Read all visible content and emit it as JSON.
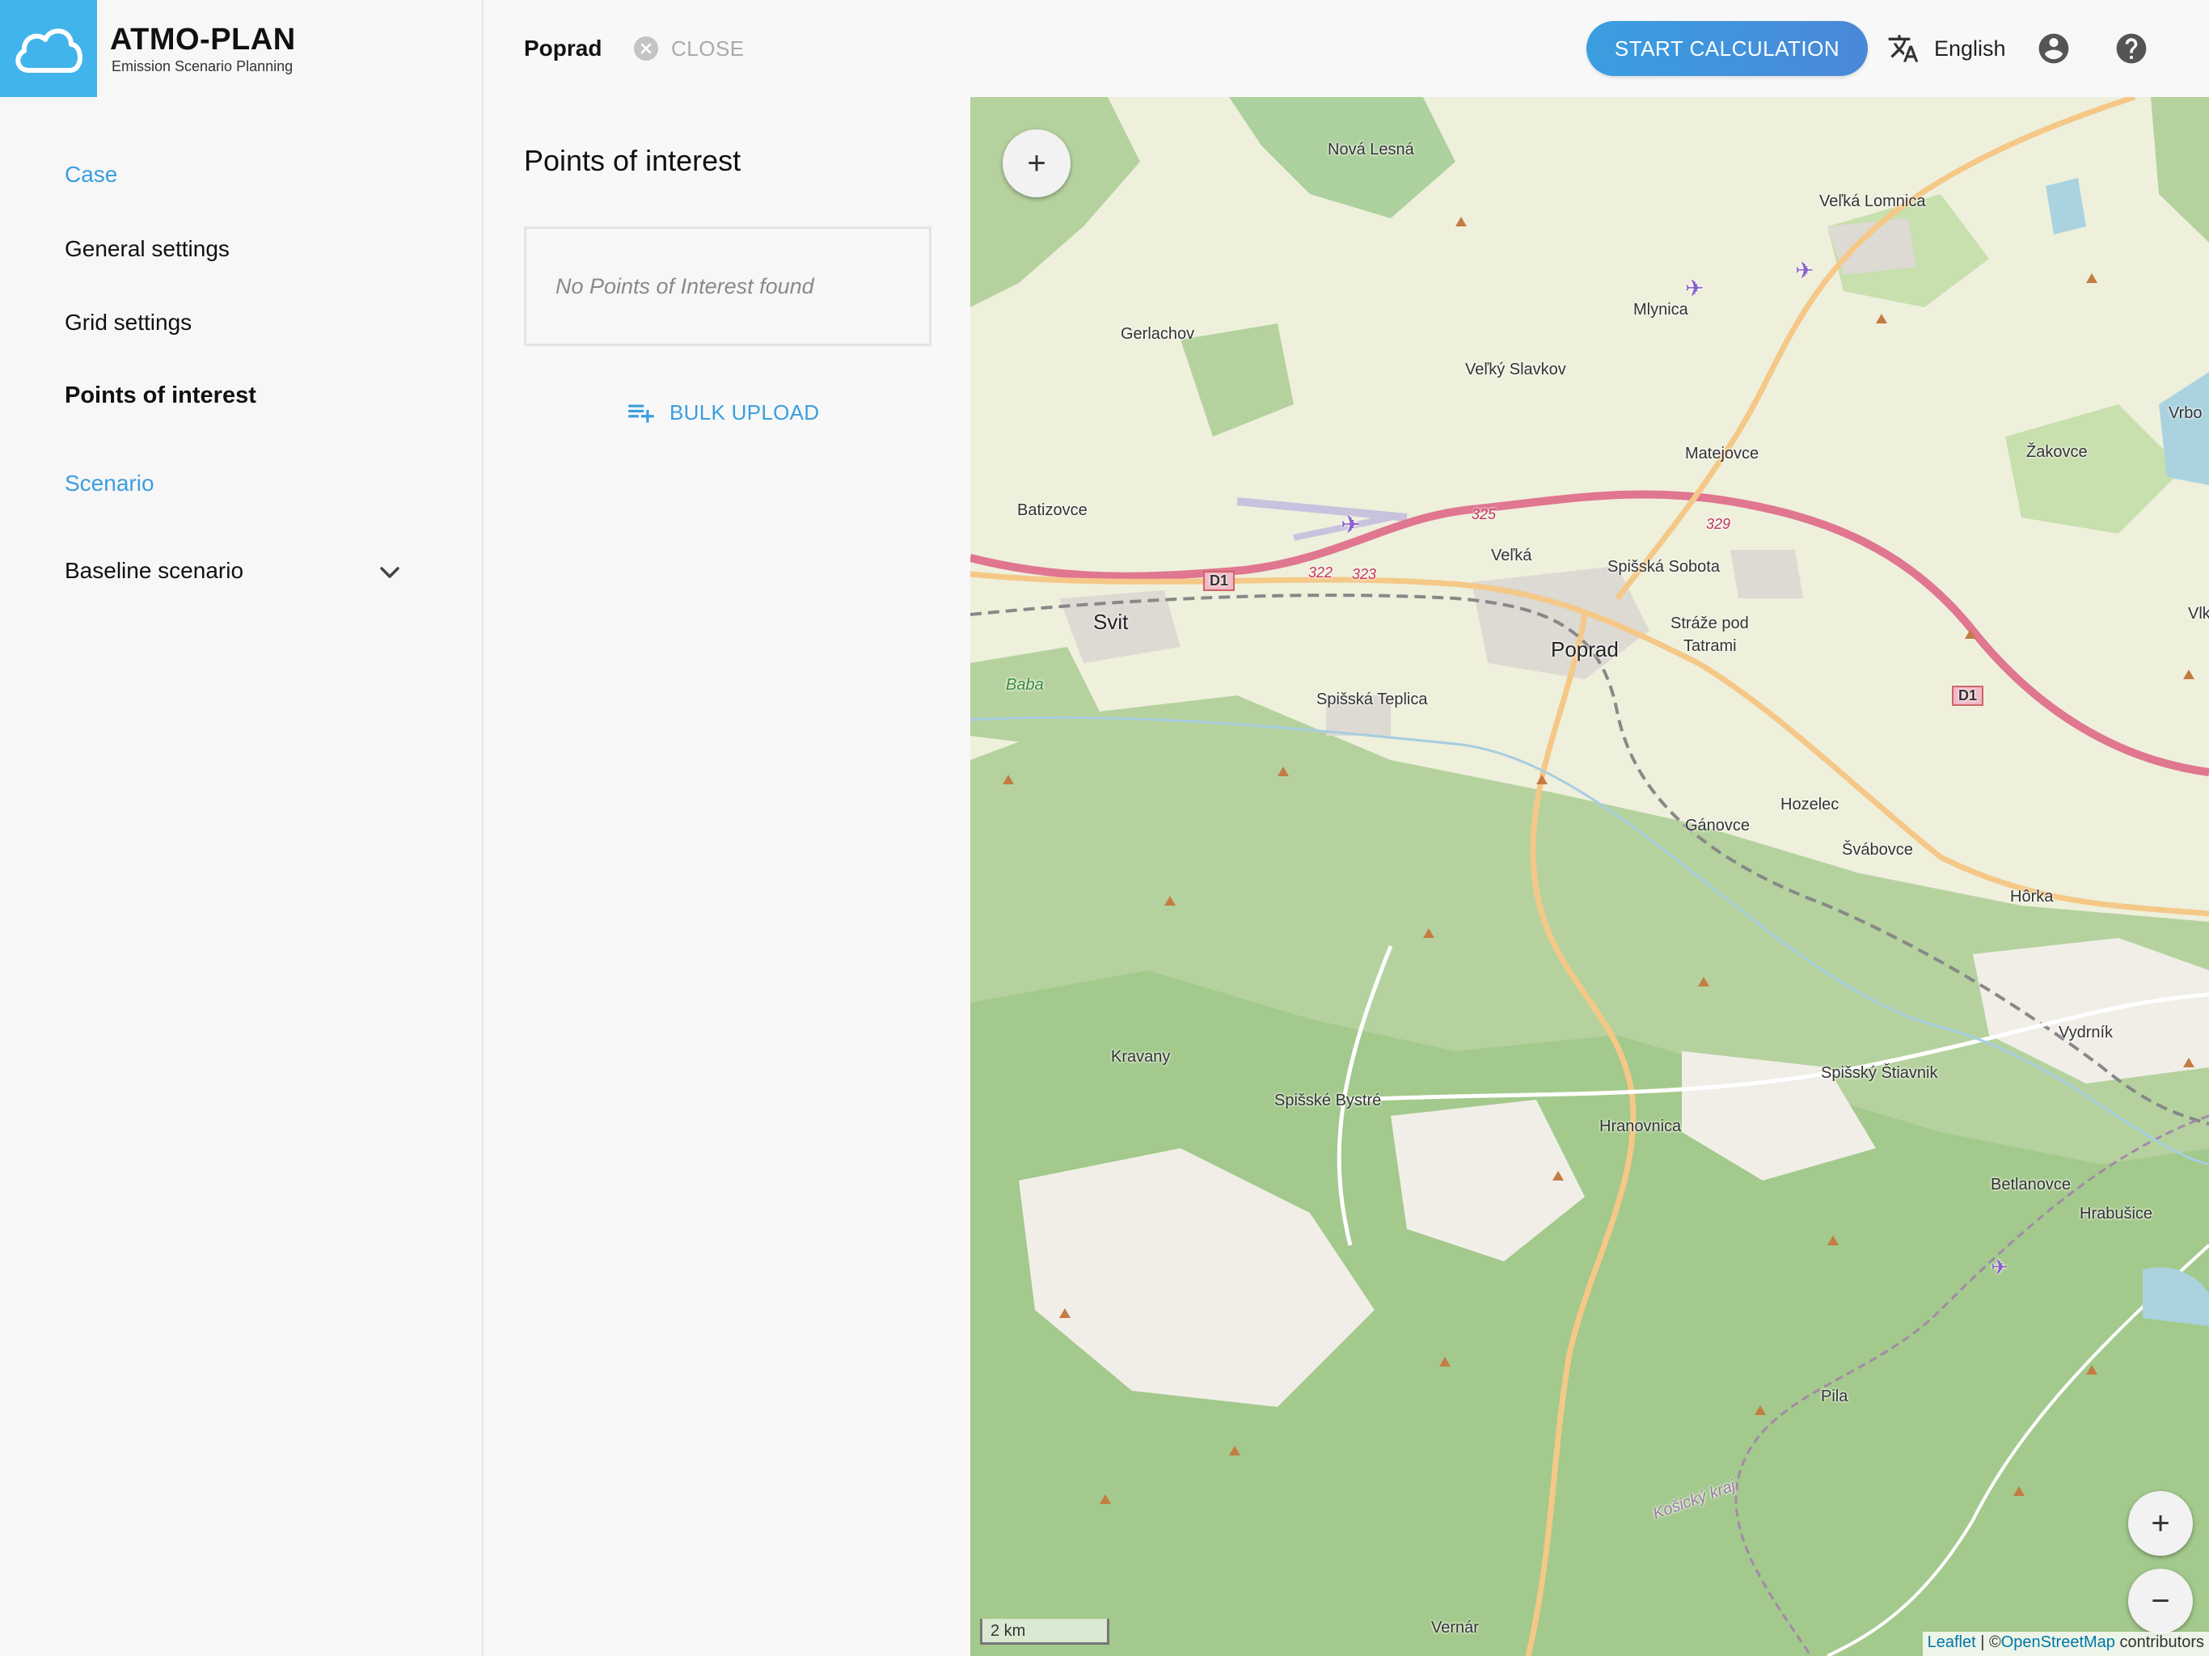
{
  "app": {
    "title": "ATMO-PLAN",
    "subtitle": "Emission Scenario Planning",
    "brand_color": "#42b4ec"
  },
  "sidebar": {
    "items": [
      {
        "label": "Case",
        "style": "link"
      },
      {
        "label": "General settings",
        "style": "normal"
      },
      {
        "label": "Grid settings",
        "style": "normal"
      },
      {
        "label": "Points of interest",
        "style": "active"
      },
      {
        "label": "Scenario",
        "style": "link"
      },
      {
        "label": "Baseline scenario",
        "style": "normal"
      }
    ]
  },
  "header": {
    "case_name": "Poprad",
    "close_label": "CLOSE",
    "start_label": "START CALCULATION",
    "language": "English"
  },
  "poi": {
    "title": "Points of interest",
    "empty_message": "No Points of Interest found",
    "bulk_label": "BULK UPLOAD"
  },
  "map": {
    "places": [
      "Nová Lesná",
      "Veľká Lomnica",
      "Mlynica",
      "Gerlachov",
      "Veľký Slavkov",
      "Matejovce",
      "Žakovce",
      "Vrbo",
      "Batizovce",
      "Veľká",
      "Spišská Sobota",
      "Svit",
      "Stráže pod",
      "Tatrami",
      "Poprad",
      "Vlk",
      "Baba",
      "Spišská Teplica",
      "Hozelec",
      "Gánovce",
      "Švábovce",
      "Hôrka",
      "Vydrník",
      "Kravany",
      "Spišský Štiavnik",
      "Spišské Bystré",
      "Hranovnica",
      "Betlanovce",
      "Hrabušice",
      "Pila",
      "Košický kraj",
      "Vernár"
    ],
    "road_labels": [
      "D1",
      "D1",
      "325",
      "329",
      "322",
      "323"
    ],
    "zoom_in": "+",
    "zoom_out": "−",
    "scale": "2 km",
    "attribution_leaflet": "Leaflet",
    "attribution_sep": " | ©",
    "attribution_osm": "OpenStreetMap",
    "attribution_tail": " contributors"
  }
}
